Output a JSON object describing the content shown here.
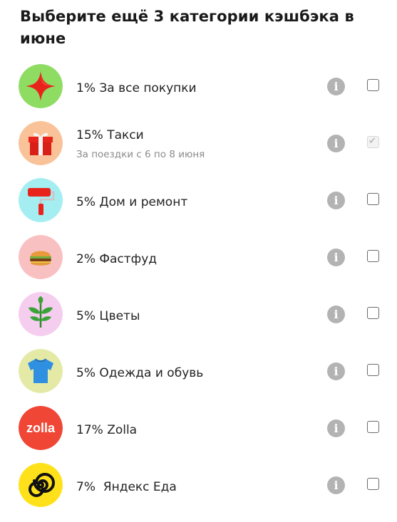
{
  "title": "Выберите ещё 3 категории кэшбэка в июне",
  "categories": [
    {
      "label": "1% За все покупки",
      "sublabel": "",
      "checked": false,
      "icon": "red-star-icon",
      "bg": "#8fdc63"
    },
    {
      "label": "15% Такси",
      "sublabel": "За поездки с 6 по 8 июня",
      "checked": true,
      "icon": "gift-box-icon",
      "bg": "#f9c298"
    },
    {
      "label": "5% Дом и ремонт",
      "sublabel": "",
      "checked": false,
      "icon": "paint-roller-icon",
      "bg": "#a4eef2"
    },
    {
      "label": "2% Фастфуд",
      "sublabel": "",
      "checked": false,
      "icon": "burger-icon",
      "bg": "#f9c0c2"
    },
    {
      "label": "5% Цветы",
      "sublabel": "",
      "checked": false,
      "icon": "leaf-sprout-icon",
      "bg": "#f5cdee"
    },
    {
      "label": "5% Одежда и обувь",
      "sublabel": "",
      "checked": false,
      "icon": "t-shirt-icon",
      "bg": "#e4eaa6"
    },
    {
      "label": "17% Zolla",
      "sublabel": "",
      "checked": false,
      "icon": "zolla-logo",
      "bg": "#f04635",
      "logo_text": "zolla"
    },
    {
      "label": "7%  Яндекс Еда",
      "sublabel": "",
      "checked": false,
      "icon": "yandex-eda-logo",
      "bg": "#ffe11b"
    }
  ],
  "info_symbol": "i",
  "check_mark": "✔"
}
